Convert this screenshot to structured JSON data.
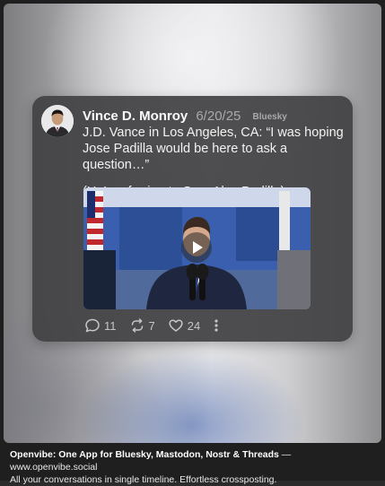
{
  "post": {
    "author": "Vince D. Monroy",
    "date": "6/20/25",
    "network": "Bluesky",
    "text_line1": "J.D. Vance in Los Angeles, CA: “I was hoping Jose Padilla would be here to ask a question…”",
    "text_line2": "(He’s referring to Sen. Alex Padilla)",
    "replies": "11",
    "reposts": "7",
    "likes": "24"
  },
  "footer": {
    "title": "Openvibe: One App for Bluesky, Mastodon, Nostr & Threads",
    "separator": " — ",
    "url": "www.openvibe.social",
    "tagline": "All your conversations in single timeline. Effortless crossposting."
  },
  "icons": {
    "reply": "speech-bubble-icon",
    "repost": "repost-arrows-icon",
    "like": "heart-icon",
    "more": "vertical-ellipsis-icon",
    "play": "play-icon"
  },
  "colors": {
    "card_bg": "#424244",
    "text": "#f2f2f2",
    "muted": "#a9a9ab"
  }
}
